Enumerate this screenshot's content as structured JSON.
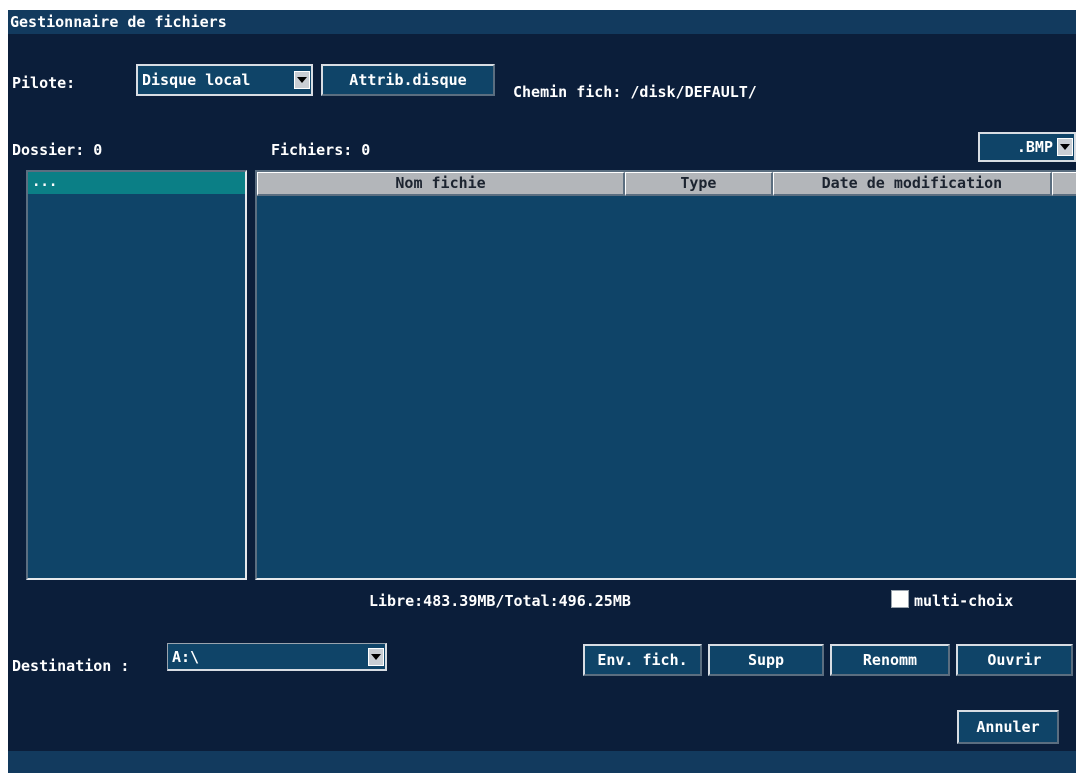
{
  "window": {
    "title": "Gestionnaire de fichiers"
  },
  "toolbar": {
    "pilote_label": "Pilote:",
    "pilote_value": "Disque local",
    "attrib_button": "Attrib.disque",
    "path": "Chemin fich: /disk/DEFAULT/"
  },
  "counts": {
    "dossier": "Dossier: 0",
    "fichiers": "Fichiers: 0"
  },
  "filter": {
    "value": ".BMP"
  },
  "folders": {
    "items": [
      {
        "label": "..."
      }
    ]
  },
  "table": {
    "columns": [
      "Nom fichie",
      "Type",
      "Date de modification",
      ""
    ],
    "rows": []
  },
  "status": {
    "space": "Libre:483.39MB/Total:496.25MB",
    "multi_label": "multi-choix",
    "multi_checked": false
  },
  "destination": {
    "label": "Destination :",
    "value": "A:\\"
  },
  "actions": {
    "send": "Env. fich.",
    "delete": "Supp",
    "rename": "Renomm",
    "open": "Ouvrir",
    "cancel": "Annuler"
  },
  "icons": {
    "dropdown": "chevron-down-icon",
    "checkbox": "checkbox-icon"
  }
}
